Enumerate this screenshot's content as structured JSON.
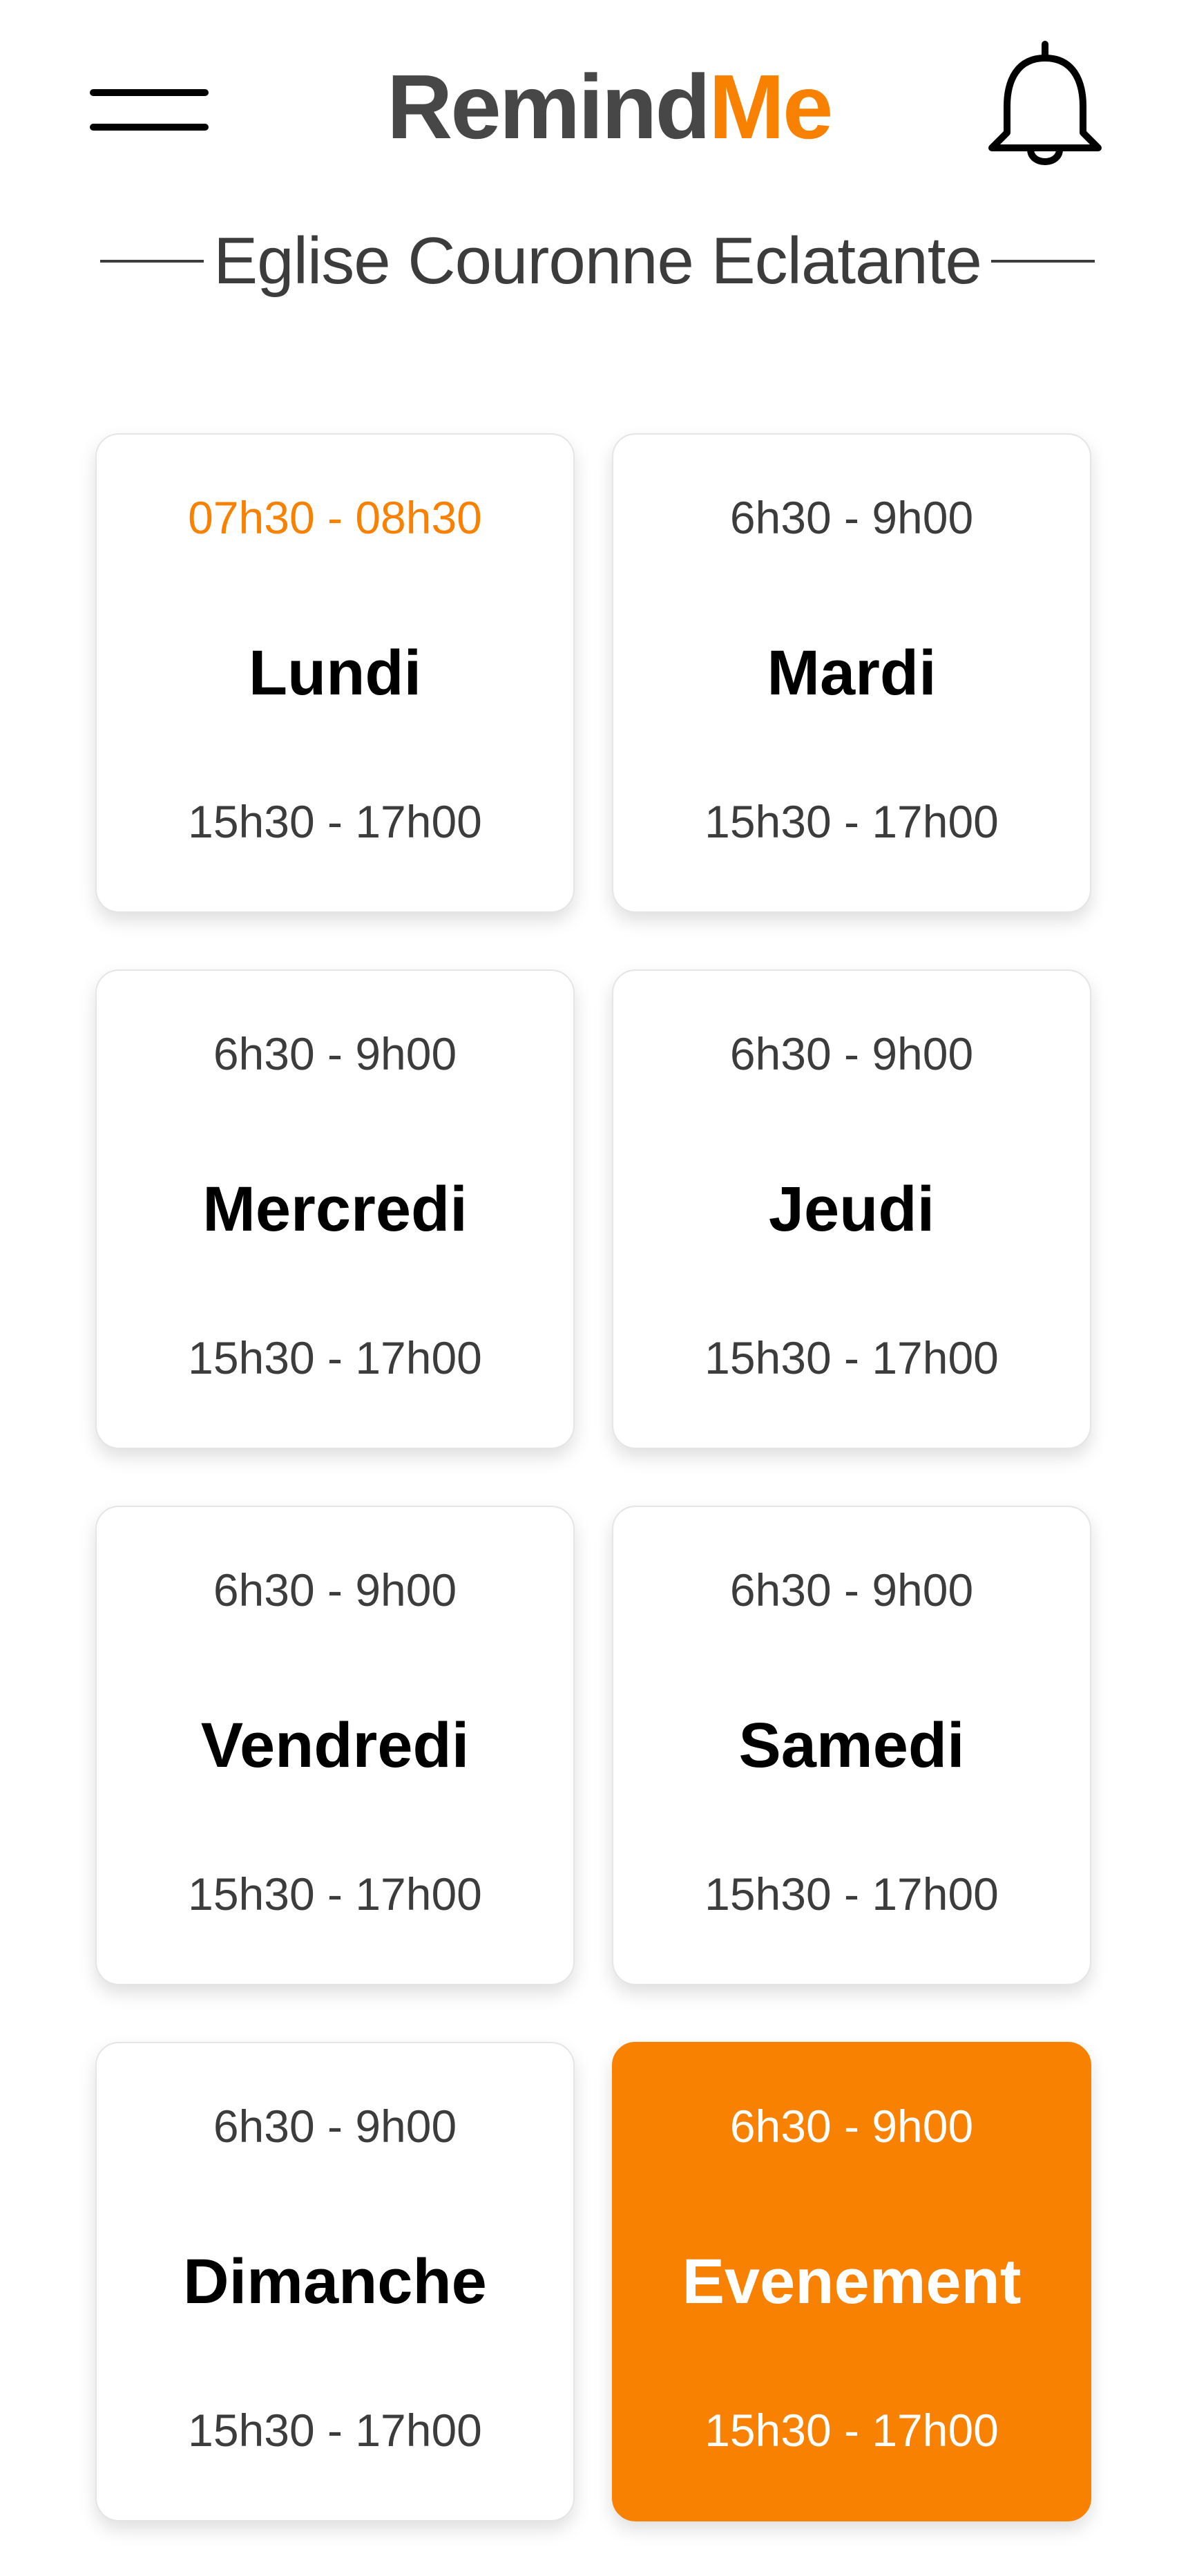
{
  "header": {
    "menu_icon": "hamburger-menu-icon",
    "title_part_a": "Remind",
    "title_part_b": "Me",
    "bell_icon": "bell-icon"
  },
  "church": {
    "name": "Eglise Couronne Eclatante"
  },
  "colors": {
    "accent": "#f98101",
    "title_dark": "#474747",
    "text_secondary": "#3c3c3c",
    "card_border": "#e5e5e5"
  },
  "days": [
    {
      "name": "Lundi",
      "morning": "07h30 - 08h30",
      "afternoon": "15h30 - 17h00"
    },
    {
      "name": "Mardi",
      "morning": "6h30 - 9h00",
      "afternoon": "15h30 - 17h00"
    },
    {
      "name": "Mercredi",
      "morning": "6h30 - 9h00",
      "afternoon": "15h30 - 17h00"
    },
    {
      "name": "Jeudi",
      "morning": "6h30 - 9h00",
      "afternoon": "15h30 - 17h00"
    },
    {
      "name": "Vendredi",
      "morning": "6h30 - 9h00",
      "afternoon": "15h30 - 17h00"
    },
    {
      "name": "Samedi",
      "morning": "6h30 - 9h00",
      "afternoon": "15h30 - 17h00"
    },
    {
      "name": "Dimanche",
      "morning": "6h30 - 9h00",
      "afternoon": "15h30 - 17h00"
    },
    {
      "name": "Evenement",
      "morning": "6h30 - 9h00",
      "afternoon": "15h30 - 17h00"
    }
  ]
}
